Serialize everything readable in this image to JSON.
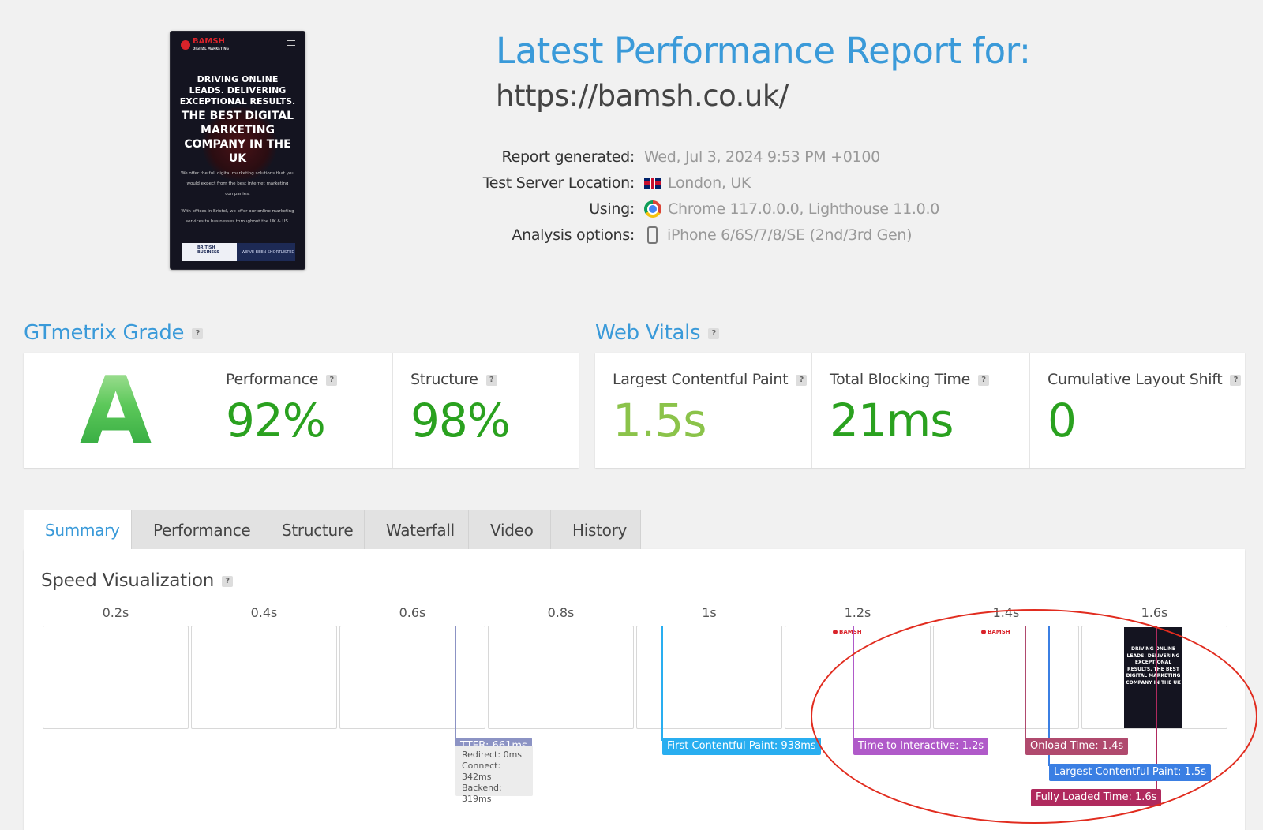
{
  "screenshot": {
    "logo_text": "BAMSH",
    "logo_sub": "DIGITAL MARKETING",
    "headline_small": "DRIVING ONLINE LEADS. DELIVERING EXCEPTIONAL RESULTS.",
    "headline_big": "THE BEST DIGITAL MARKETING COMPANY IN THE UK",
    "body_1": "We offer the full digital marketing solutions that you would expect from the best internet marketing companies.",
    "body_2": "With offices in Bristol, we offer our online marketing services to businesses throughout the UK & US.",
    "banner_left": "BRITISH BUSINESS",
    "banner_right": "WE'VE BEEN SHORTLISTED"
  },
  "report": {
    "title": "Latest Performance Report for:",
    "url": "https://bamsh.co.uk/",
    "meta": [
      {
        "label": "Report generated:",
        "value": "Wed, Jul 3, 2024 9:53 PM +0100",
        "icon": "none"
      },
      {
        "label": "Test Server Location:",
        "value": "London, UK",
        "icon": "uk-flag-icon"
      },
      {
        "label": "Using:",
        "value": "Chrome 117.0.0.0, Lighthouse 11.0.0",
        "icon": "chrome-icon"
      },
      {
        "label": "Analysis options:",
        "value": "iPhone 6/6S/7/8/SE (2nd/3rd Gen)",
        "icon": "phone-icon"
      }
    ]
  },
  "grade": {
    "title": "GTmetrix Grade",
    "help": "?",
    "letter": "A",
    "performance_label": "Performance",
    "performance_value": "92%",
    "structure_label": "Structure",
    "structure_value": "98%"
  },
  "vitals": {
    "title": "Web Vitals",
    "help": "?",
    "lcp_label": "Largest Contentful Paint",
    "lcp_value": "1.5s",
    "tbt_label": "Total Blocking Time",
    "tbt_value": "21ms",
    "cls_label": "Cumulative Layout Shift",
    "cls_value": "0"
  },
  "tabs": [
    "Summary",
    "Performance",
    "Structure",
    "Waterfall",
    "Video",
    "History"
  ],
  "active_tab": "Summary",
  "speed": {
    "title": "Speed Visualization",
    "help": "?",
    "ticks": [
      "0.2s",
      "0.4s",
      "0.6s",
      "0.8s",
      "1s",
      "1.2s",
      "1.4s",
      "1.6s"
    ],
    "frame_logo": "BAMSH",
    "frame_headline": "DRIVING ONLINE LEADS. DELIVERING EXCEPTIONAL RESULTS. THE BEST DIGITAL MARKETING COMPANY IN THE UK",
    "markers": {
      "ttfb": "TTFB: 661ms",
      "ttfb_redirect": "Redirect: 0ms",
      "ttfb_connect": "Connect: 342ms",
      "ttfb_backend": "Backend: 319ms",
      "fcp": "First Contentful Paint: 938ms",
      "tti": "Time to Interactive: 1.2s",
      "onload": "Onload Time: 1.4s",
      "lcp": "Largest Contentful Paint: 1.5s",
      "fully_loaded": "Fully Loaded Time: 1.6s"
    }
  },
  "colors": {
    "accent": "#3a9ad9",
    "grade_green": "#2aa33a",
    "value_green": "#2aa11f",
    "lcp_green": "#8bc34a",
    "ttfb": "#8c93c4",
    "fcp": "#29aef0",
    "tti": "#b05ac9",
    "onload": "#b04a6e",
    "lcp": "#3b7fe3",
    "fully_loaded": "#b02a5e",
    "annotation_circle": "#e12c1f"
  }
}
